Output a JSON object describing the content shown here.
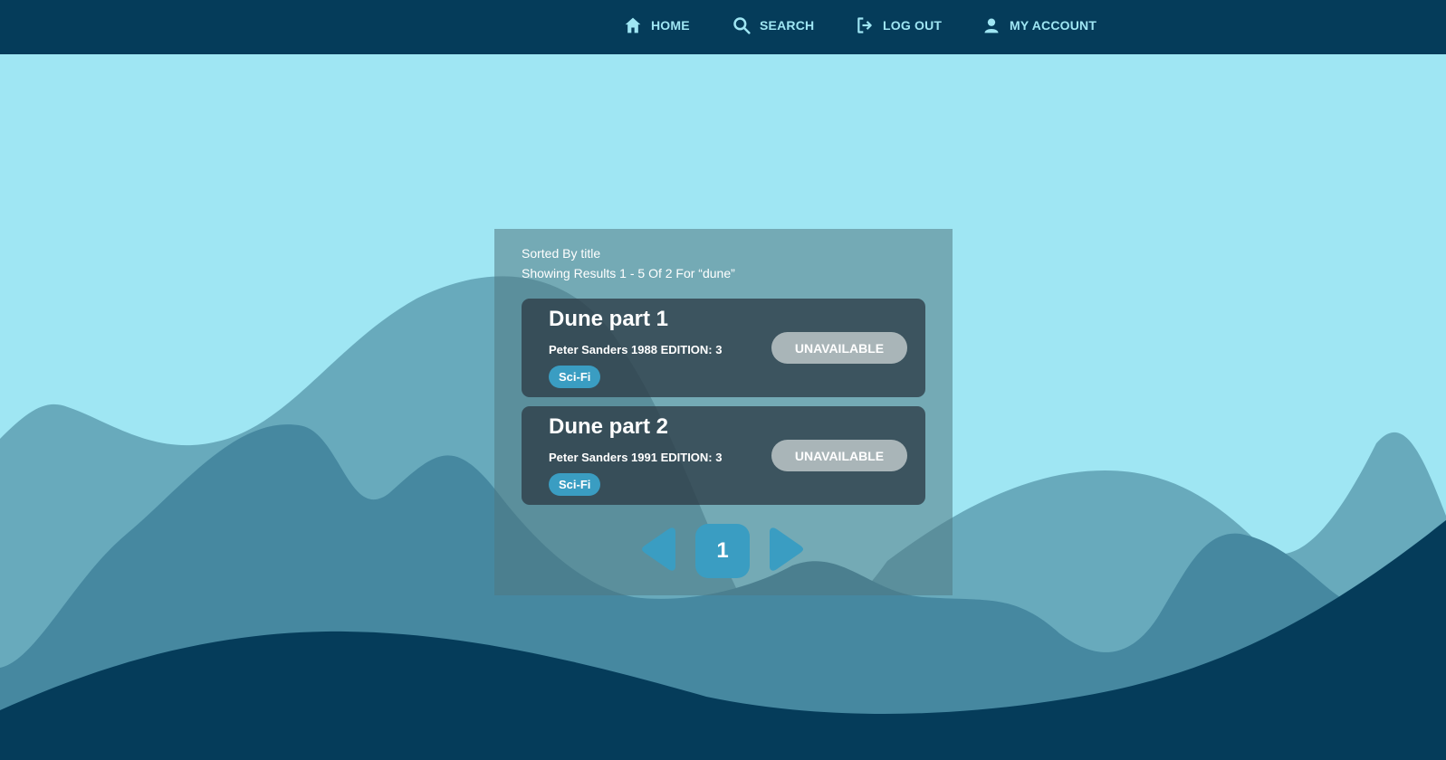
{
  "nav": {
    "items": [
      {
        "label": "HOME",
        "icon": "home-icon"
      },
      {
        "label": "SEARCH",
        "icon": "search-icon"
      },
      {
        "label": "LOG OUT",
        "icon": "logout-icon"
      },
      {
        "label": "MY ACCOUNT",
        "icon": "user-icon"
      }
    ]
  },
  "results": {
    "sorted_by": "Sorted By title",
    "showing": "Showing Results 1 - 5 Of 2 For “dune”",
    "books": [
      {
        "title": "Dune part 1",
        "details": "Peter Sanders 1988 EDITION: 3",
        "genre": "Sci-Fi",
        "status": "UNAVAILABLE"
      },
      {
        "title": "Dune part 2",
        "details": "Peter Sanders 1991 EDITION: 3",
        "genre": "Sci-Fi",
        "status": "UNAVAILABLE"
      }
    ]
  },
  "pagination": {
    "current_page": "1",
    "prev_icon": "chevron-left-icon",
    "next_icon": "chevron-right-icon"
  },
  "colors": {
    "navbar": "#053c5a",
    "sky": "#9fe6f3",
    "accent": "#3a9dc2",
    "unavailable": "#a9b5b8"
  }
}
